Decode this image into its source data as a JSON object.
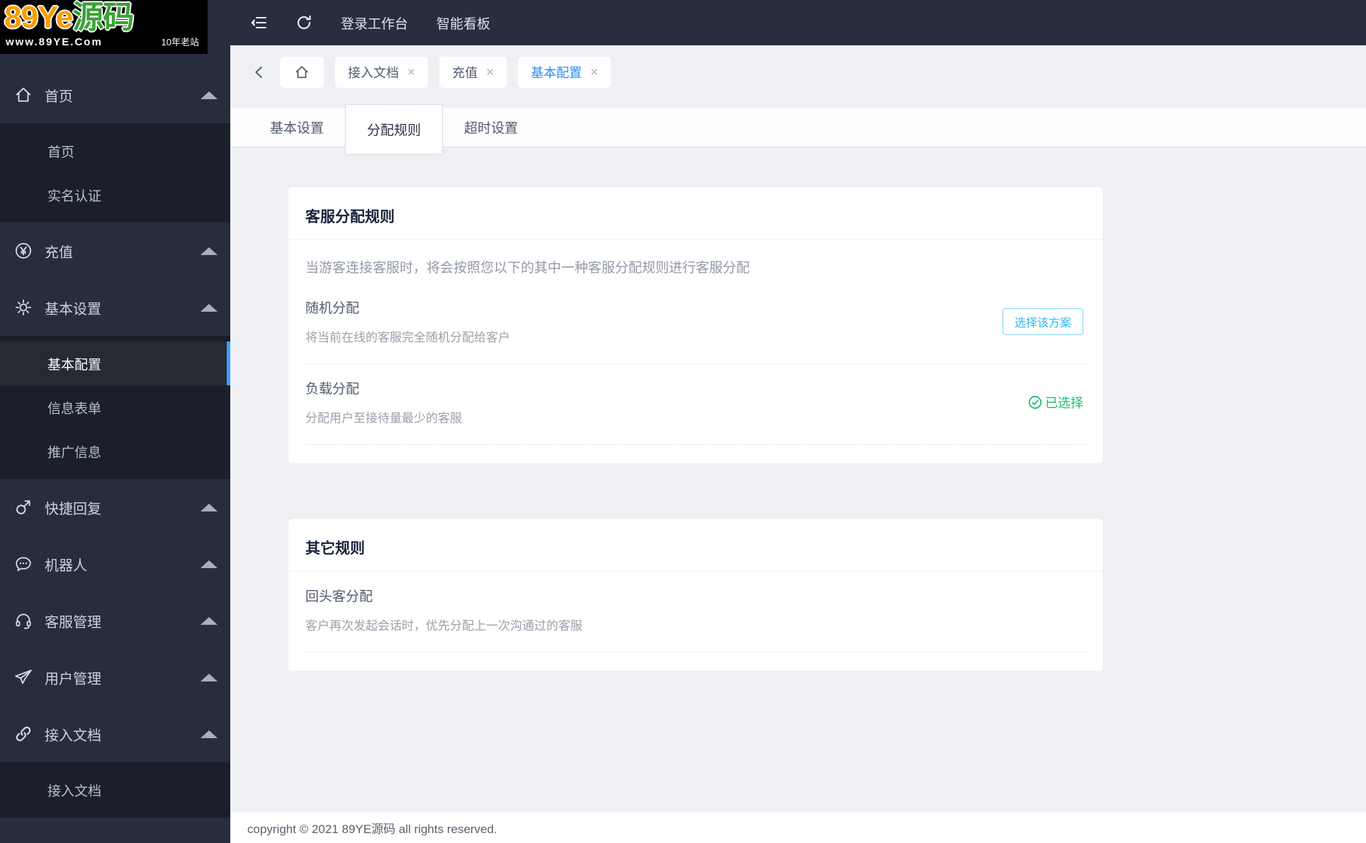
{
  "colors": {
    "accent": "#2d8cf0",
    "info": "#2db7f5",
    "success": "#19be6b",
    "toggle-on": "#1583f7",
    "active-bar": "#3d9bff",
    "brand-orange": "#ff9b00",
    "brand-green": "#3aa335"
  },
  "logo": {
    "brand": "89Ye",
    "brand_suffix": "源码",
    "url": "www.89YE.Com",
    "tag": "10年老站"
  },
  "topbar": {
    "workbench": "登录工作台",
    "dashboard": "智能看板"
  },
  "crumbs": {
    "close_glyph": "×",
    "tabs": [
      {
        "label": "接入文档",
        "active": false
      },
      {
        "label": "充值",
        "active": false
      },
      {
        "label": "基本配置",
        "active": true
      }
    ]
  },
  "tabs": [
    {
      "label": "基本设置",
      "active": false
    },
    {
      "label": "分配规则",
      "active": true
    },
    {
      "label": "超时设置",
      "active": false
    }
  ],
  "sidebar": {
    "items": [
      {
        "label": "首页",
        "icon": "home-icon",
        "expanded": true,
        "children": [
          {
            "label": "首页"
          },
          {
            "label": "实名认证"
          }
        ]
      },
      {
        "label": "充值",
        "icon": "yen-circle-icon"
      },
      {
        "label": "基本设置",
        "icon": "gear-icon",
        "expanded": true,
        "children": [
          {
            "label": "基本配置",
            "active": true
          },
          {
            "label": "信息表单"
          },
          {
            "label": "推广信息"
          }
        ]
      },
      {
        "label": "快捷回复",
        "icon": "mars-icon"
      },
      {
        "label": "机器人",
        "icon": "robot-chat-icon"
      },
      {
        "label": "客服管理",
        "icon": "headset-icon"
      },
      {
        "label": "用户管理",
        "icon": "paper-plane-icon"
      },
      {
        "label": "接入文档",
        "icon": "link-icon",
        "expanded": true,
        "children": [
          {
            "label": "接入文档"
          }
        ]
      }
    ]
  },
  "cards": [
    {
      "title": "客服分配规则",
      "description": "当游客连接客服时，将会按照您以下的其中一种客服分配规则进行客服分配",
      "options": [
        {
          "name": "随机分配",
          "desc": "将当前在线的客服完全随机分配给客户",
          "action_label": "选择该方案"
        },
        {
          "name": "负载分配",
          "desc": "分配用户至接待量最少的客服",
          "selected_label": "已选择"
        }
      ]
    },
    {
      "title": "其它规则",
      "options": [
        {
          "name": "回头客分配",
          "desc": "客户再次发起会话时，优先分配上一次沟通过的客服",
          "enabled": true
        }
      ]
    }
  ],
  "footer": {
    "copyright": "copyright © 2021 89YE源码 all rights reserved."
  }
}
